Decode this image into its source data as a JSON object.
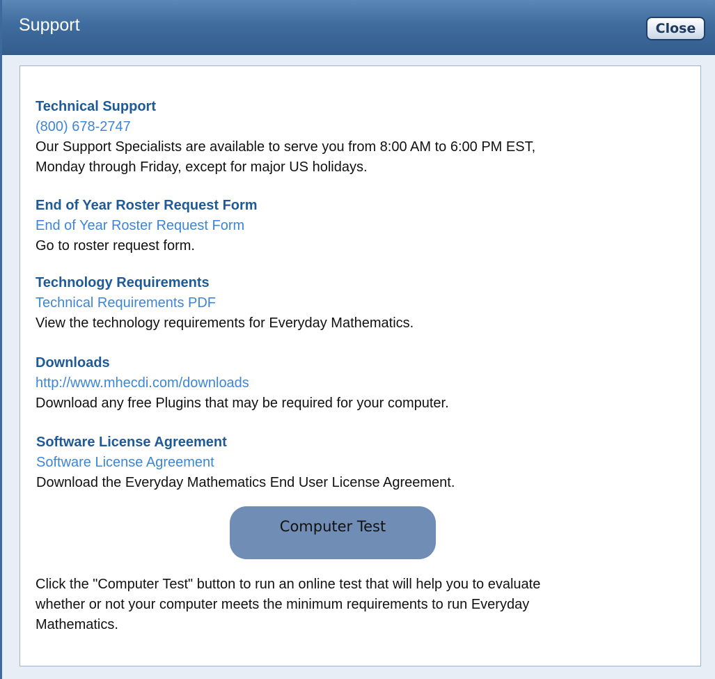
{
  "dialog": {
    "title": "Support",
    "close_label": "Close"
  },
  "sections": [
    {
      "heading": "Technical Support",
      "link": "(800) 678-2747",
      "description_lines": [
        "Our Support Specialists are available to serve you from 8:00 AM to 6:00 PM EST,",
        "Monday through Friday, except for major US holidays."
      ]
    },
    {
      "heading": "End of Year Roster Request Form",
      "link": "End of Year Roster Request Form",
      "description_lines": [
        "Go to roster request form."
      ]
    },
    {
      "heading": "Technology Requirements",
      "link": "Technical Requirements PDF",
      "description_lines": [
        "View the technology requirements for Everyday Mathematics."
      ]
    },
    {
      "heading": "Downloads",
      "link": "http://www.mhecdi.com/downloads",
      "description_lines": [
        "Download any free Plugins that may be required for your computer."
      ]
    },
    {
      "heading": "Software License Agreement",
      "link": "Software License Agreement",
      "description_lines": [
        "Download the Everyday Mathematics End User License Agreement."
      ]
    }
  ],
  "computer_test": {
    "button_label": "Computer Test",
    "description_lines": [
      "Click the \"Computer Test\" button to run an online test that will help you to evaluate",
      "whether or not your computer meets the minimum requirements to run Everyday",
      "Mathematics."
    ]
  },
  "colors": {
    "title_bar": "#3f6c9e",
    "heading": "#1f5a96",
    "link": "#3d86d6",
    "test_button": "#6f8db5"
  }
}
